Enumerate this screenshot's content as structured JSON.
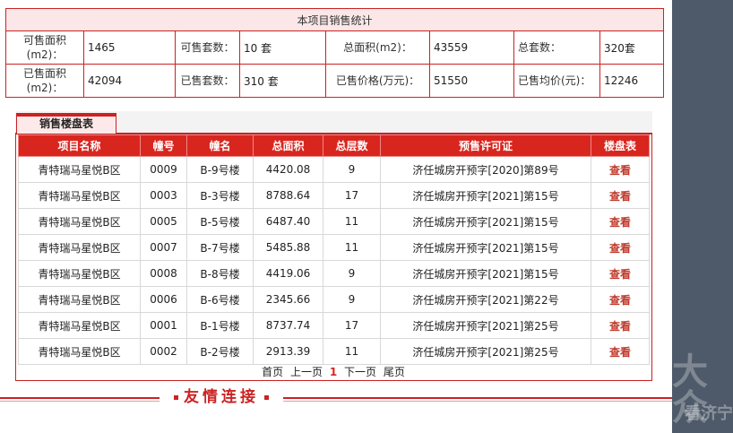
{
  "stats": {
    "title": "本项目销售统计",
    "row1": {
      "available_area_label": "可售面积",
      "available_area_unit": "(m2)：",
      "available_area": "1465",
      "available_units_label": "可售套数：",
      "available_units": "10 套",
      "total_area_label": "总面积(m2)：",
      "total_area": "43559",
      "total_units_label": "总套数：",
      "total_units": "320套"
    },
    "row2": {
      "sold_area_label": "已售面积",
      "sold_area_unit": "(m2)：",
      "sold_area": "42094",
      "sold_units_label": "已售套数：",
      "sold_units": "310 套",
      "sold_price_label": "已售价格(万元)：",
      "sold_price": "51550",
      "avg_price_label": "已售均价(元)：",
      "avg_price": "12246"
    }
  },
  "buildings": {
    "tab_label": "销售楼盘表",
    "headers": [
      "项目名称",
      "幢号",
      "幢名",
      "总面积",
      "总层数",
      "预售许可证",
      "楼盘表"
    ],
    "rows": [
      [
        "青特瑞马星悦B区",
        "0009",
        "B-9号楼",
        "4420.08",
        "9",
        "济任城房开预字[2020]第89号",
        "查看"
      ],
      [
        "青特瑞马星悦B区",
        "0003",
        "B-3号楼",
        "8788.64",
        "17",
        "济任城房开预字[2021]第15号",
        "查看"
      ],
      [
        "青特瑞马星悦B区",
        "0005",
        "B-5号楼",
        "6487.40",
        "11",
        "济任城房开预字[2021]第15号",
        "查看"
      ],
      [
        "青特瑞马星悦B区",
        "0007",
        "B-7号楼",
        "5485.88",
        "11",
        "济任城房开预字[2021]第15号",
        "查看"
      ],
      [
        "青特瑞马星悦B区",
        "0008",
        "B-8号楼",
        "4419.06",
        "9",
        "济任城房开预字[2021]第15号",
        "查看"
      ],
      [
        "青特瑞马星悦B区",
        "0006",
        "B-6号楼",
        "2345.66",
        "9",
        "济任城房开预字[2021]第22号",
        "查看"
      ],
      [
        "青特瑞马星悦B区",
        "0001",
        "B-1号楼",
        "8737.74",
        "17",
        "济任城房开预字[2021]第25号",
        "查看"
      ],
      [
        "青特瑞马星悦B区",
        "0002",
        "B-2号楼",
        "2913.39",
        "11",
        "济任城房开预字[2021]第25号",
        "查看"
      ]
    ]
  },
  "pager": {
    "first": "首页",
    "prev": "上一页",
    "current": "1",
    "next": "下一页",
    "last": "尾页"
  },
  "friend_links": {
    "title": "友情连接"
  },
  "watermark": {
    "logo_text": "大众",
    "sub_text": "看济宁"
  },
  "colors": {
    "accent": "#d8261f",
    "side_panel": "#4e5a69",
    "tab_bg": "#fde9e9"
  }
}
